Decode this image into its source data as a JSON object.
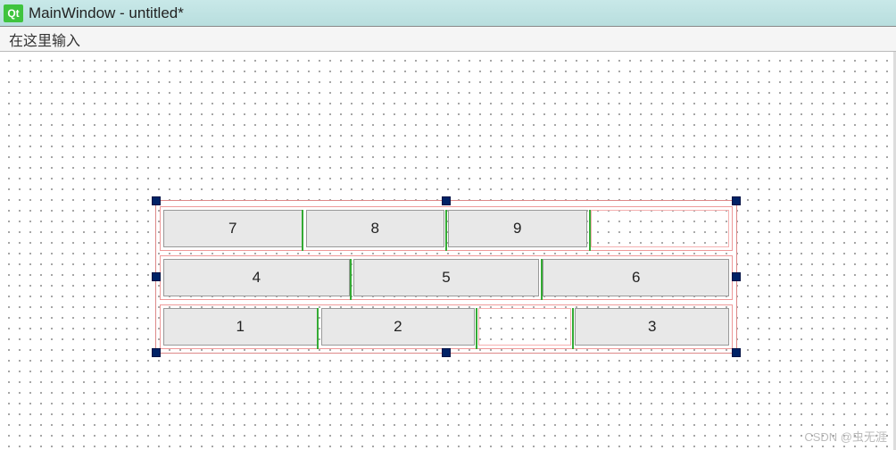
{
  "window": {
    "title": "MainWindow - untitled*",
    "logo_text": "Qt"
  },
  "menubar": {
    "placeholder": "在这里输入"
  },
  "layout": {
    "rows": [
      {
        "cells": [
          {
            "type": "button",
            "label": "7"
          },
          {
            "type": "button",
            "label": "8"
          },
          {
            "type": "button",
            "label": "9"
          },
          {
            "type": "empty"
          }
        ]
      },
      {
        "cells": [
          {
            "type": "button",
            "label": "4"
          },
          {
            "type": "button",
            "label": "5"
          },
          {
            "type": "button",
            "label": "6"
          }
        ]
      },
      {
        "cells": [
          {
            "type": "button",
            "label": "1"
          },
          {
            "type": "button",
            "label": "2"
          },
          {
            "type": "empty"
          },
          {
            "type": "button",
            "label": "3"
          }
        ]
      }
    ]
  },
  "watermark": "CSDN @虫无涯"
}
